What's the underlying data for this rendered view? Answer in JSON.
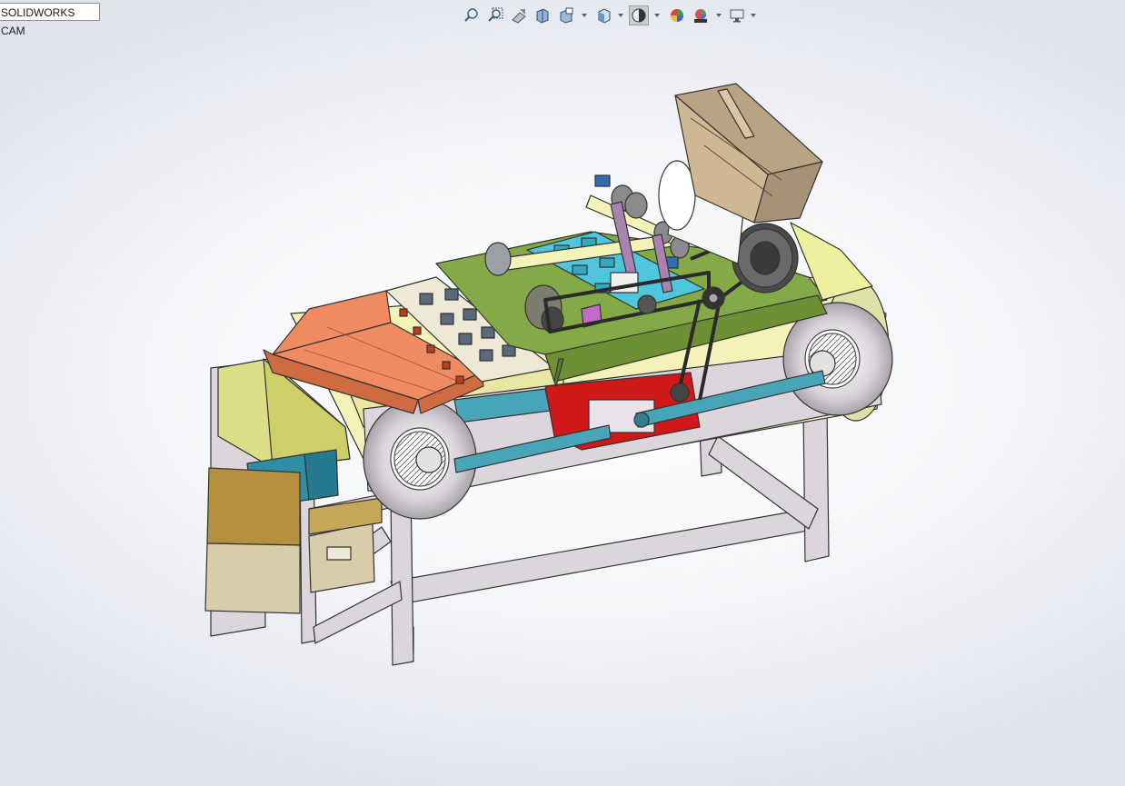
{
  "app": {
    "tab_label": "SOLIDWORKS CAM"
  },
  "heads_up_toolbar": {
    "buttons": [
      {
        "id": "zoom-to-fit",
        "icon": "zoom-to-fit-icon"
      },
      {
        "id": "zoom-to-area",
        "icon": "zoom-to-area-icon"
      },
      {
        "id": "previous-view",
        "icon": "previous-view-icon"
      },
      {
        "id": "section-view",
        "icon": "section-view-icon"
      },
      {
        "id": "dynamic-annotation",
        "icon": "dynamic-annotation-icon"
      },
      {
        "id": "view-orientation",
        "icon": "view-orientation-icon",
        "has_menu": true
      },
      {
        "id": "display-style",
        "icon": "display-style-icon",
        "has_menu": true,
        "active": true
      },
      {
        "id": "edit-appearance",
        "icon": "edit-appearance-icon"
      },
      {
        "id": "apply-scene",
        "icon": "apply-scene-icon",
        "has_menu": true
      },
      {
        "id": "view-settings",
        "icon": "view-settings-icon",
        "has_menu": true
      }
    ]
  },
  "model": {
    "colors": {
      "frame": "#dcd6dc",
      "frame_edge": "#3a3a3a",
      "orange_cover": "#f08a60",
      "green_plate": "#84aa48",
      "cyan_plate": "#4ec7dc",
      "hopper": "#cdb893",
      "belt_yellow": "#f4f2b8",
      "shaft_blue": "#48a5b8",
      "red_part": "#d01818",
      "hopper_tray": "#dede88",
      "drawer_tan": "#b38f3e",
      "teal_box": "#2f8ea6"
    }
  }
}
